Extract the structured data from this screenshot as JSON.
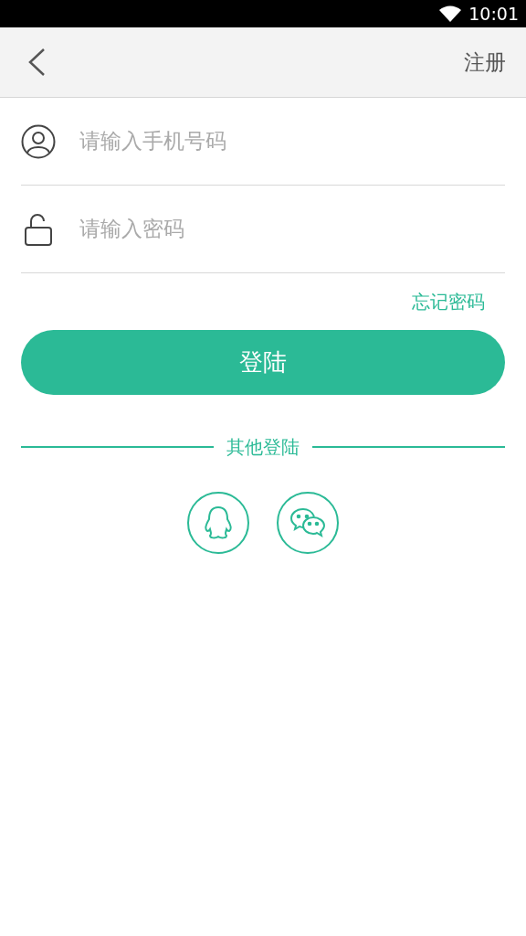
{
  "status_bar": {
    "time": "10:01"
  },
  "header": {
    "action": "注册"
  },
  "fields": [
    {
      "kind": "phone",
      "placeholder": "请输入手机号码"
    },
    {
      "kind": "password",
      "placeholder": "请输入密码"
    }
  ],
  "forgot_password": "忘记密码",
  "login_button": "登陆",
  "other_login": {
    "label": "其他登陆",
    "providers": [
      {
        "kind": "qq"
      },
      {
        "kind": "wechat"
      }
    ]
  }
}
